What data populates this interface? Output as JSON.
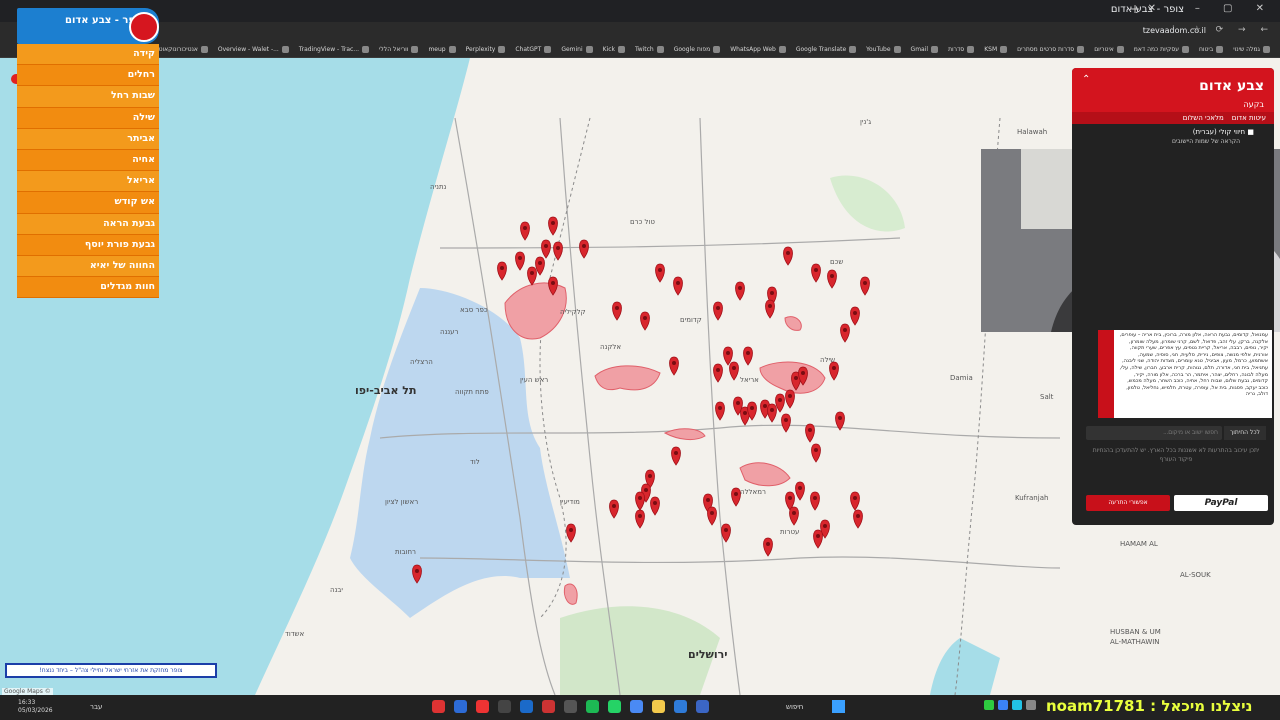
{
  "browser": {
    "tab_title": "צופר - צבע אדום",
    "url": "tzevaadom.co.il",
    "bookmarks": [
      "גמלה שינוי",
      "ביטוח",
      "עסקיות כמה דאמ",
      "איטריום",
      "סדרות סרטים מסתרים",
      "KSM",
      "סדרות",
      "Gmail",
      "YouTube",
      "Google Translate",
      "WhatsApp Web",
      "Google מפות",
      "Twitch",
      "Kick",
      "Gemini",
      "ChatGPT",
      "Perplexity",
      "meup",
      "ווריאל הללי",
      "TradingView - Trac...",
      "Overview - Walet -...",
      "אנטיכורונוקאוטי ישראלי",
      "דרך גבר - דויד דירדה"
    ]
  },
  "areas_panel": {
    "title": "צופר - צבע אדום",
    "items": [
      "קידה",
      "רחלים",
      "שבות רחל",
      "שילה",
      "אביתר",
      "אחיה",
      "אריאל",
      "אש קודש",
      "גבעת הראה",
      "גבעת פורת יוסף",
      "החווה של יאיא",
      "חוות מגדלים"
    ]
  },
  "map": {
    "city_labels": [
      "תל אביב-יפו",
      "ירושלים"
    ],
    "town_labels": [
      "נתניה",
      "כפר סבא",
      "רעננה",
      "הרצליה",
      "פתח תקווה",
      "ראש העין",
      "אריאל",
      "קדומים",
      "שילה",
      "רמאללה",
      "מודיעין",
      "לוד",
      "ראשון לציון",
      "רחובות",
      "אשדוד",
      "יבנה",
      "שכם",
      "טול כרם",
      "קלקיליה",
      "אלקנה",
      "עטרות",
      "ג'נין",
      "Damia",
      "Halawah",
      "HAMAM AL",
      "AL-SOUK",
      "HUSBAN & UM",
      "AL-MATHAWIN",
      "Salt",
      "Kufranjah"
    ],
    "attribution": "Google Maps ©"
  },
  "alert_panel": {
    "title": "צבע אדום",
    "subtitle": "בקעה",
    "tabs": [
      "עיטות אדום",
      "מלאכי השלום"
    ],
    "checkbox_label": "חיווי קולי (עברית)",
    "checkbox_sub": "הקראה של שמות היישובים",
    "alert_text": "עמנואל, קדומים, גבעת הראה, אלון מורה, ברוכין, בית אריה – עופרים, אלקנה, ברקן, עלי זהב, פדואל, לשם, קרני שומרון, מעלה שומרון, יקיר, נופים, רבבה, אריאל, קריית נטפים, עץ אפרים, שערי תקווה, אורנית, אלפי מנשה, צופים, נירית, סלעית, חגי, סוסיה, שמעה, אשתמוע, כרמל, מעון, אביגיל, טנא עומרים, מצדות יהודה, שני ליבנה, עתניאל, בית חגי, אדורה, תלם, נגוהות, קרית ארבע, חברון, שילה, עלי, מעלה לבונה, רחלים, יצהר, איתמר, הר ברכה, אלון מורה, יקיר, קדומים, גבעת שלום, שבות רחל, אחיה, כוכב השחר, מעלה מכמש, כוכב יעקב, פסגות, בית אל, עופרה, עטרת, חלמיש, נחליאל, טלמון, דולב, נריה",
    "search_placeholder": "חפשו ישוב או מיקום...",
    "search_button": "לכל החיתוך",
    "note": "יתכן עיכוב בהתרעות לא אשננות בכל הארץ. יש להתעדכן בהנחיות פיקוד העורף",
    "support_button": "אפשורי התרעה",
    "paypal_button": "PayPal"
  },
  "banner": {
    "text": "צופר מחזקת את אזרחי ישראל וחיילי צה\"ל – ביחד ננצח!"
  },
  "taskbar": {
    "time": "16:33",
    "date": "05/03/2026",
    "lang": "עבר",
    "search": "חיפוש",
    "subscriber_banner": "ניצלנו מיכאל : noam71781"
  },
  "colors": {
    "alert_red": "#d3141e",
    "pin_red": "#d8262d",
    "area_orange": "#f28c10",
    "header_blue": "#1c7fd0",
    "sea": "#a6dde8",
    "metro_blue": "#b7d4ef"
  }
}
